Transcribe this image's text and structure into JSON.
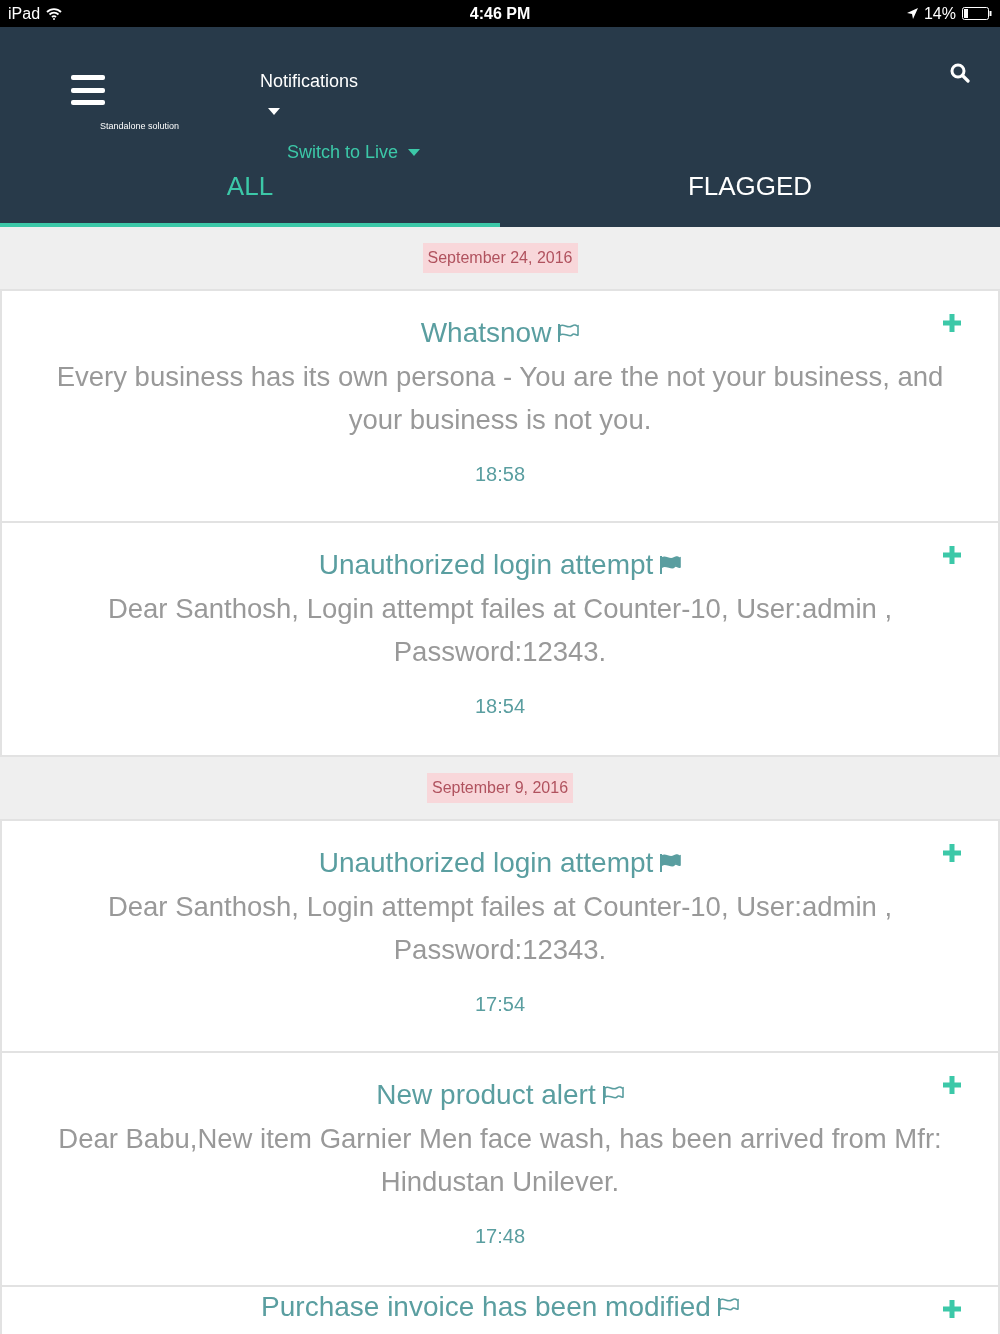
{
  "status_bar": {
    "carrier": "iPad",
    "time": "4:46 PM",
    "battery": "14%"
  },
  "header": {
    "title": "Notifications",
    "subtitle": "Standalone solution",
    "switch": "Switch to Live"
  },
  "tabs": [
    {
      "label": "ALL",
      "selected": true
    },
    {
      "label": "FLAGGED",
      "selected": false
    }
  ],
  "groups": [
    {
      "date": "September 24, 2016",
      "notifications": [
        {
          "title": "Whatsnow",
          "flagged": false,
          "message": "Every business has its own persona - You are the not your business, and your business is not you.",
          "time": "18:58"
        },
        {
          "title": "Unauthorized login attempt",
          "flagged": true,
          "message": "Dear Santhosh, Login attempt failes at Counter-10, User:admin , Password:12343.",
          "time": "18:54"
        }
      ]
    },
    {
      "date": "September 9, 2016",
      "notifications": [
        {
          "title": "Unauthorized login attempt",
          "flagged": true,
          "message": "Dear Santhosh, Login attempt failes at Counter-10, User:admin , Password:12343.",
          "time": "17:54"
        },
        {
          "title": "New product alert",
          "flagged": false,
          "message": "Dear Babu,New item Garnier Men face wash, has been arrived from Mfr: Hindustan Unilever.",
          "time": "17:48"
        },
        {
          "title": "Purchase invoice has been modified",
          "flagged": false
        }
      ]
    }
  ]
}
